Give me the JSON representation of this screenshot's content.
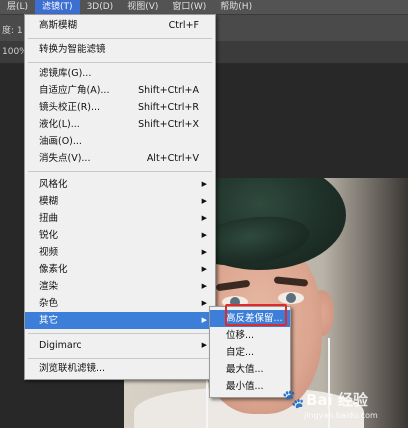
{
  "menubar": {
    "items": [
      {
        "label": "层(L)"
      },
      {
        "label": "滤镜(T)"
      },
      {
        "label": "3D(D)"
      },
      {
        "label": "视图(V)"
      },
      {
        "label": "窗口(W)"
      },
      {
        "label": "帮助(H)"
      }
    ]
  },
  "options_bar": {
    "label": "度: 1"
  },
  "tab_row": {
    "zoom_fragment": "100%"
  },
  "filter_menu": {
    "items": [
      {
        "label": "高斯模糊",
        "shortcut": "Ctrl+F"
      },
      {
        "label": "转换为智能滤镜"
      },
      {
        "label": "滤镜库(G)..."
      },
      {
        "label": "自适应广角(A)...",
        "shortcut": "Shift+Ctrl+A"
      },
      {
        "label": "镜头校正(R)...",
        "shortcut": "Shift+Ctrl+R"
      },
      {
        "label": "液化(L)...",
        "shortcut": "Shift+Ctrl+X"
      },
      {
        "label": "油画(O)..."
      },
      {
        "label": "消失点(V)...",
        "shortcut": "Alt+Ctrl+V"
      },
      {
        "label": "风格化"
      },
      {
        "label": "模糊"
      },
      {
        "label": "扭曲"
      },
      {
        "label": "锐化"
      },
      {
        "label": "视频"
      },
      {
        "label": "像素化"
      },
      {
        "label": "渲染"
      },
      {
        "label": "杂色"
      },
      {
        "label": "其它"
      },
      {
        "label": "Digimarc"
      },
      {
        "label": "浏览联机滤镜..."
      }
    ]
  },
  "other_submenu": {
    "items": [
      {
        "label": "高反差保留..."
      },
      {
        "label": "位移..."
      },
      {
        "label": "自定..."
      },
      {
        "label": "最大值..."
      },
      {
        "label": "最小值..."
      }
    ]
  },
  "watermark": {
    "brand": "Bai 经验",
    "url": "jingyan.baidu.com"
  },
  "colors": {
    "highlight": "#3d7fd8",
    "callout": "#e12a2a",
    "menu_bg": "#f0f0f0",
    "app_bg": "#535353"
  }
}
